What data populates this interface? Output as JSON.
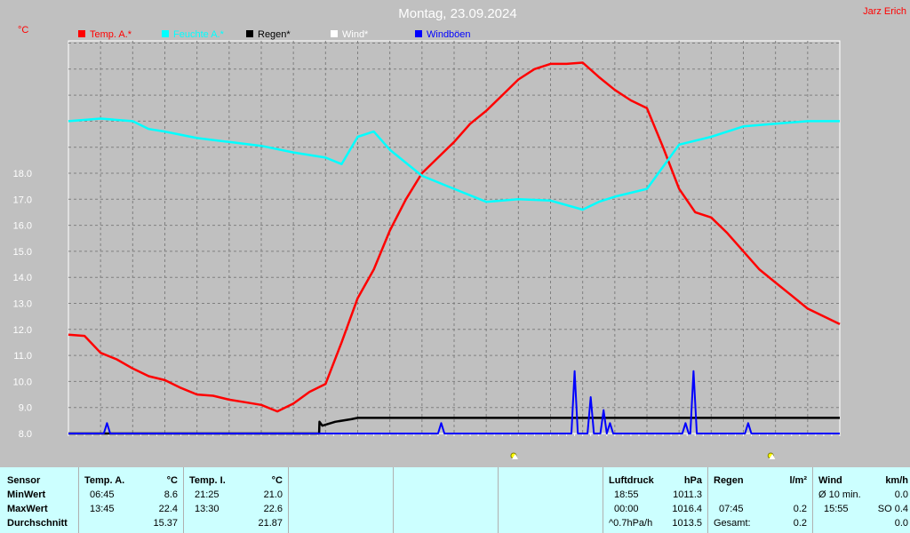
{
  "header": {
    "date": "Montag, 23.09.2024",
    "author": "Jarz Erich",
    "unit": "°C"
  },
  "legend": [
    {
      "label": "Temp. A.*",
      "color": "#ff0000"
    },
    {
      "label": "Feuchte A.*",
      "color": "#00ffff"
    },
    {
      "label": "Regen*",
      "color": "#000000"
    },
    {
      "label": "Wind*",
      "color": "#ffffff"
    },
    {
      "label": "Windböen",
      "color": "#0000ff"
    }
  ],
  "chart_data": {
    "type": "line",
    "x_range_hours": [
      0,
      24
    ],
    "ylim": [
      8.0,
      18.0
    ],
    "yticks": [
      "8.0",
      "9.0",
      "10.0",
      "11.0",
      "12.0",
      "13.0",
      "14.0",
      "15.0",
      "16.0",
      "17.0",
      "18.0"
    ],
    "grid": true,
    "series": [
      {
        "name": "Temp. A.*",
        "color": "#ff0000",
        "x": [
          0,
          0.5,
          1,
          1.5,
          2,
          2.5,
          3,
          3.5,
          4,
          4.5,
          5,
          5.5,
          6,
          6.5,
          7,
          7.5,
          8,
          8.5,
          9,
          9.5,
          10,
          10.5,
          11,
          11.5,
          12,
          12.5,
          13,
          13.5,
          14,
          14.5,
          15,
          15.5,
          16,
          16.5,
          17,
          17.5,
          18,
          18.5,
          19,
          19.5,
          20,
          20.5,
          21,
          21.5,
          22,
          22.5,
          23,
          23.5,
          24
        ],
        "y": [
          11.8,
          11.75,
          11.1,
          10.85,
          10.5,
          10.2,
          10.05,
          9.75,
          9.5,
          9.45,
          9.3,
          9.2,
          9.1,
          8.85,
          9.15,
          9.6,
          9.9,
          11.5,
          13.2,
          14.3,
          15.8,
          17.0,
          18.0,
          18.6,
          19.2,
          19.9,
          20.4,
          21.0,
          21.6,
          22.0,
          22.2,
          22.2,
          22.25,
          21.7,
          21.2,
          20.8,
          20.5,
          19.0,
          17.4,
          16.5,
          16.3,
          15.7,
          15.0,
          14.3,
          13.8,
          13.3,
          12.8,
          12.5,
          12.2
        ]
      },
      {
        "name": "Feuchte A.*",
        "color": "#00ffff",
        "x": [
          0,
          1,
          2,
          2.5,
          3,
          4,
          5,
          6,
          7,
          8,
          8.5,
          9,
          9.5,
          10,
          11,
          12,
          13,
          14,
          15,
          16,
          16.5,
          17,
          18,
          19,
          20,
          21,
          22,
          23,
          24
        ],
        "y": [
          20.0,
          20.1,
          20.0,
          19.7,
          19.6,
          19.35,
          19.2,
          19.05,
          18.8,
          18.6,
          18.35,
          19.4,
          19.6,
          18.9,
          17.9,
          17.4,
          16.9,
          17.0,
          16.95,
          16.6,
          16.9,
          17.1,
          17.4,
          19.1,
          19.4,
          19.8,
          19.9,
          20.0,
          20.0
        ]
      },
      {
        "name": "Regen*",
        "color": "#000000",
        "x": [
          0,
          7.8,
          7.81,
          7.9,
          8.3,
          8.8,
          9,
          24
        ],
        "y": [
          8.0,
          8.0,
          8.45,
          8.3,
          8.45,
          8.55,
          8.6,
          8.6
        ]
      },
      {
        "name": "Windböen",
        "color": "#0000ff",
        "x": [
          0,
          1.1,
          1.2,
          1.3,
          11.5,
          11.6,
          11.7,
          15.65,
          15.75,
          15.85,
          16.15,
          16.25,
          16.35,
          16.55,
          16.65,
          16.75,
          16.85,
          16.95,
          19.1,
          19.2,
          19.3,
          19.35,
          19.45,
          19.55,
          21.05,
          21.15,
          21.25,
          24
        ],
        "y": [
          8.0,
          8.0,
          8.4,
          8.0,
          8.0,
          8.4,
          8.0,
          8.0,
          10.4,
          8.0,
          8.0,
          9.4,
          8.0,
          8.0,
          8.9,
          8.0,
          8.4,
          8.0,
          8.0,
          8.4,
          8.0,
          8.0,
          10.4,
          8.0,
          8.0,
          8.4,
          8.0,
          8.0
        ]
      }
    ]
  },
  "sun_events": [
    {
      "name": "sunrise",
      "hour": 13.85
    },
    {
      "name": "sunset",
      "hour": 21.85
    }
  ],
  "stats": {
    "sensor": "Sensor",
    "rows": [
      "MinWert",
      "MaxWert",
      "Durchschnitt"
    ],
    "temp_a": {
      "header": "Temp. A.",
      "unit": "°C",
      "min_time": "06:45",
      "min": "8.6",
      "max_time": "13:45",
      "max": "22.4",
      "avg": "15.37"
    },
    "temp_i": {
      "header": "Temp. I.",
      "unit": "°C",
      "min_time": "21:25",
      "min": "21.0",
      "max_time": "13:30",
      "max": "22.6",
      "avg": "21.87"
    },
    "luftdruck": {
      "header": "Luftdruck",
      "unit": "hPa",
      "min_time": "18:55",
      "min": "1011.3",
      "max_time": "00:00",
      "max": "1016.4",
      "trend_label": "^0.7hPa/h",
      "trend": "1013.5"
    },
    "regen": {
      "header": "Regen",
      "unit": "l/m²",
      "max_time": "07:45",
      "max": "0.2",
      "total_label": "Gesamt:",
      "total": "0.2"
    },
    "wind": {
      "header": "Wind",
      "unit": "km/h",
      "avg_label": "Ø 10 min.",
      "avg": "0.0",
      "max_time": "15:55",
      "max": "SO 0.4",
      "avg2": "0.0"
    }
  }
}
